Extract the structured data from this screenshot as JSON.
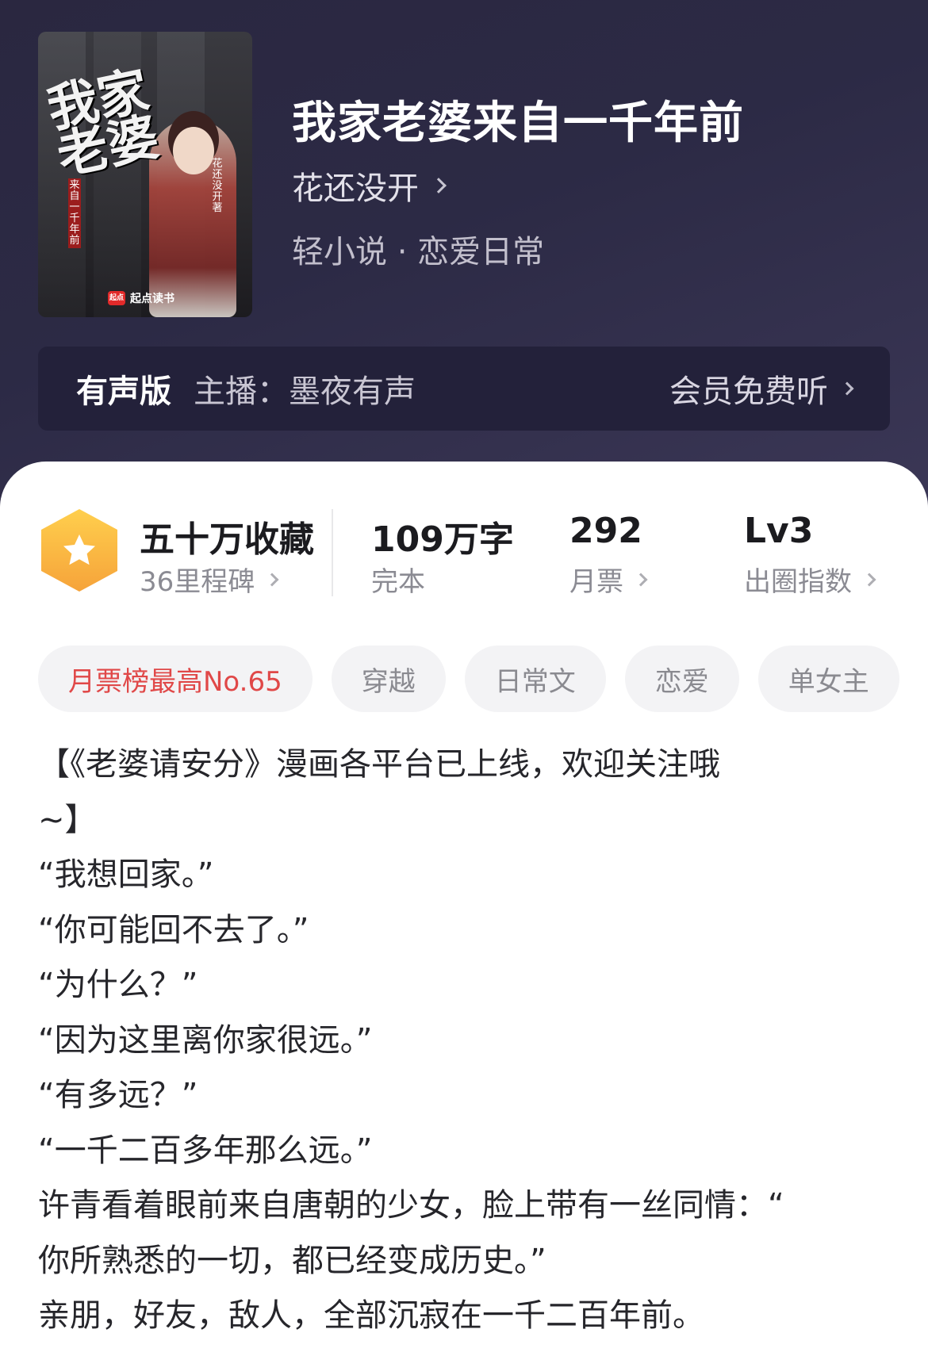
{
  "book": {
    "title": "我家老婆来自一千年前",
    "author": "花还没开",
    "genre": "轻小说 · 恋爱日常",
    "cover": {
      "title_art": "我家老婆",
      "subtitle_art": "来自一千年前",
      "author_art": "花还没开著",
      "brand": "起点读书",
      "brand_badge": "起点"
    }
  },
  "audio": {
    "label": "有声版",
    "host": "主播：墨夜有声",
    "action": "会员免费听"
  },
  "stats": {
    "collect_main": "五十万收藏",
    "collect_sub": "36里程碑",
    "words_main": "109万字",
    "words_sub": "完本",
    "votes_main": "292",
    "votes_sub": "月票",
    "level_main": "Lv3",
    "level_sub": "出圈指数",
    "badge_color": "#f6a33a"
  },
  "tags": [
    "月票榜最高No.65",
    "穿越",
    "日常文",
    "恋爱",
    "单女主"
  ],
  "blurb": [
    "【《老婆请安分》漫画各平台已上线，欢迎关注哦",
    "~】",
    "“我想回家。”",
    "“你可能回不去了。”",
    "“为什么？”",
    "“因为这里离你家很远。”",
    "“有多远？”",
    "“一千二百多年那么远。”",
    "许青看着眼前来自唐朝的少女，脸上带有一丝同情：“",
    "你所熟悉的一切，都已经变成历史。”",
    "亲朋，好友，敌人，全部沉寂在一千二百年前。"
  ]
}
